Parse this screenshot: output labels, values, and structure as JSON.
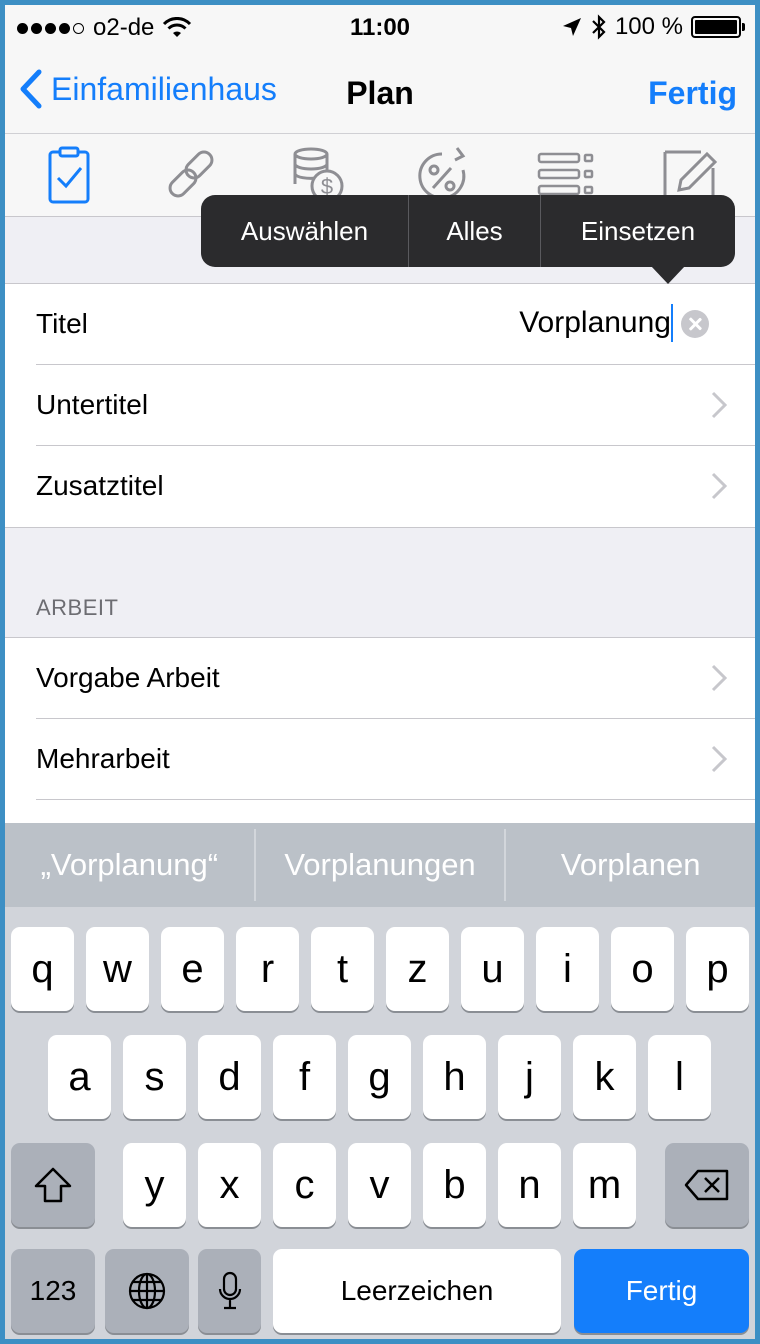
{
  "status_bar": {
    "carrier": "o2-de",
    "time": "11:00",
    "battery": "100 %"
  },
  "nav": {
    "back_label": "Einfamilienhaus",
    "title": "Plan",
    "done_label": "Fertig"
  },
  "toolbar": {
    "icons": [
      "clipboard-check-icon",
      "link-icon",
      "coins-icon",
      "percent-cycle-icon",
      "list-icon",
      "edit-pencil-icon"
    ]
  },
  "callout": {
    "items": [
      "Auswählen",
      "Alles",
      "Einsetzen"
    ]
  },
  "form": {
    "group1": {
      "title_label": "Titel",
      "title_value": "Vorplanung",
      "subtitle_label": "Untertitel",
      "extra_title_label": "Zusatztitel"
    },
    "section_header": "ARBEIT",
    "group2": {
      "work_label": "Vorgabe Arbeit",
      "overtime_label": "Mehrarbeit"
    }
  },
  "predictive": {
    "suggestions": [
      "„Vorplanung“",
      "Vorplanungen",
      "Vorplanen"
    ]
  },
  "keyboard": {
    "row1": [
      "q",
      "w",
      "e",
      "r",
      "t",
      "z",
      "u",
      "i",
      "o",
      "p"
    ],
    "row2": [
      "a",
      "s",
      "d",
      "f",
      "g",
      "h",
      "j",
      "k",
      "l"
    ],
    "row3": [
      "y",
      "x",
      "c",
      "v",
      "b",
      "n",
      "m"
    ],
    "numbers_label": "123",
    "space_label": "Leerzeichen",
    "return_label": "Fertig"
  },
  "colors": {
    "accent": "#147efb",
    "callout_bg": "#2b2b2d"
  }
}
